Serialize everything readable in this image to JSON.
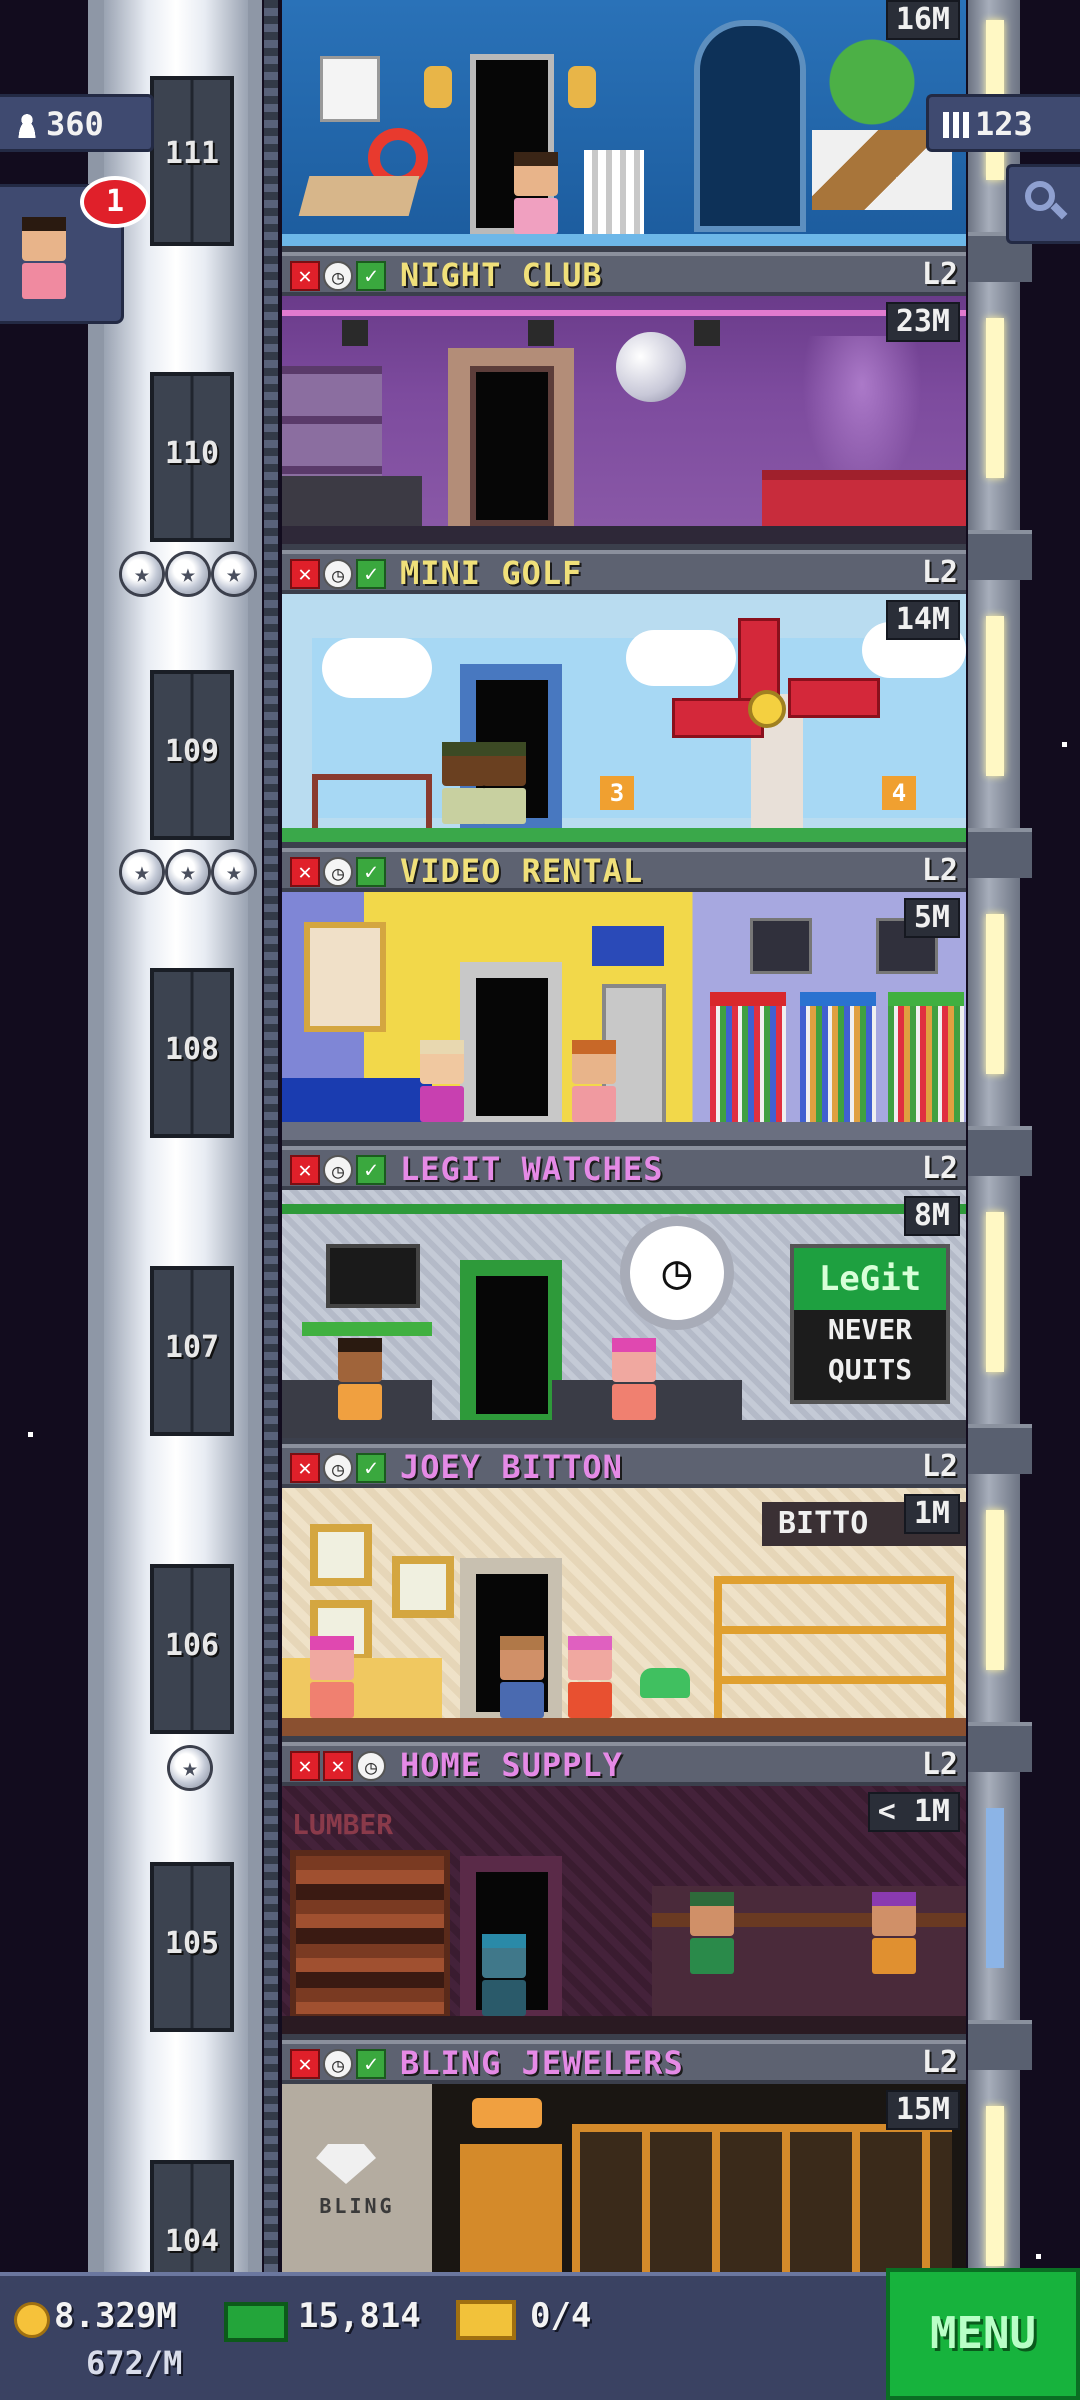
{
  "hud": {
    "population": "360",
    "floor_count": "123",
    "notification_count": "1"
  },
  "top_floor": {
    "number": "111",
    "earnings": "16M"
  },
  "floors": [
    {
      "number": "110",
      "name": "NIGHT CLUB",
      "level": "L2",
      "earnings": "23M",
      "name_color": "#f0e07a"
    },
    {
      "number": "109",
      "name": "MINI GOLF",
      "level": "L2",
      "earnings": "14M",
      "name_color": "#f0e07a"
    },
    {
      "number": "108",
      "name": "VIDEO RENTAL",
      "level": "L2",
      "earnings": "5M",
      "name_color": "#f0e07a"
    },
    {
      "number": "107",
      "name": "LEGIT WATCHES",
      "level": "L2",
      "earnings": "8M",
      "name_color": "#e58ae6"
    },
    {
      "number": "106",
      "name": "JOEY BITTON",
      "level": "L2",
      "earnings": "1M",
      "name_color": "#e58ae6"
    },
    {
      "number": "105",
      "name": "HOME SUPPLY",
      "level": "L2",
      "earnings": "< 1M",
      "name_color": "#e58ae6"
    },
    {
      "number": "104",
      "name": "BLING JEWELERS",
      "level": "L2",
      "earnings": "15M",
      "name_color": "#e58ae6"
    }
  ],
  "signs": {
    "legit_logo": "LeGit",
    "legit_slogan_1": "NEVER",
    "legit_slogan_2": "QUITS",
    "bitton_sign": "BITTO",
    "lumber_sign": "LUMBER",
    "golf_hole_3": "3",
    "golf_hole_4": "4",
    "bling_sign": "BLING"
  },
  "bottom_bar": {
    "coins": "8.329M",
    "coin_rate": "672/M",
    "bux": "15,814",
    "tickets": "0/4",
    "menu_label": "MENU"
  },
  "colors": {
    "accent_green": "#17b33d",
    "hud_blue": "#3f4a70",
    "close_red": "#e0202a",
    "check_green": "#3aa83e"
  }
}
